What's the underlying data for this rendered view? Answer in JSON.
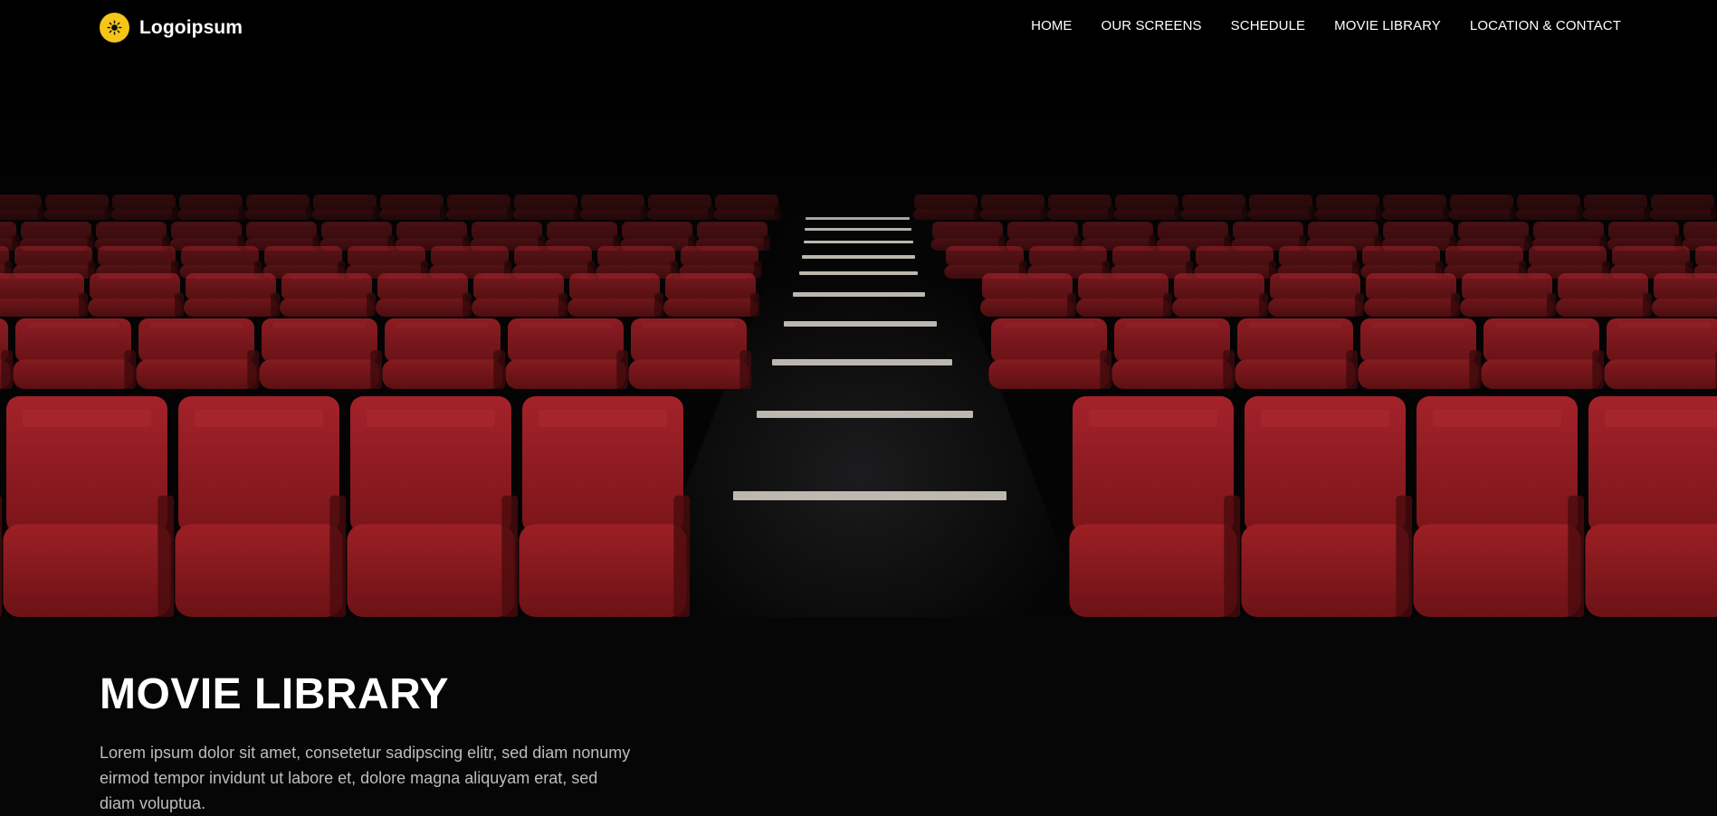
{
  "brand": {
    "name": "Logoipsum",
    "accent_color": "#f5c518",
    "logo_icon": "sun-icon"
  },
  "nav": {
    "items": [
      {
        "label": "HOME"
      },
      {
        "label": "OUR SCREENS"
      },
      {
        "label": "SCHEDULE"
      },
      {
        "label": "MOVIE LIBRARY"
      },
      {
        "label": "LOCATION & CONTACT"
      }
    ]
  },
  "hero": {
    "image": "cinema-seats-photo",
    "seat_color": "#8e1a1e"
  },
  "main": {
    "title": "MOVIE LIBRARY",
    "intro": "Lorem ipsum dolor sit amet, consetetur sadipscing elitr, sed diam nonumy eirmod tempor invidunt ut labore et, dolore magna aliquyam erat, sed diam voluptua."
  }
}
